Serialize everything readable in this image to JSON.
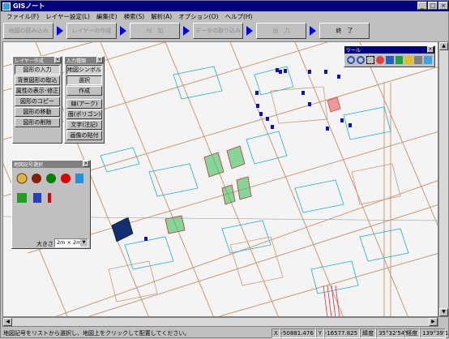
{
  "app": {
    "title": "GISノート"
  },
  "window_buttons": [
    "_",
    "□",
    "×"
  ],
  "menu": [
    "ファイル(F)",
    "レイヤー設定(L)",
    "編集(E)",
    "検索(S)",
    "解析(A)",
    "オプション(O)",
    "ヘルプ(H)"
  ],
  "steps": [
    "地図の読み込み",
    "レイヤーの作成",
    "付　加",
    "データの取り込み",
    "出　力",
    "終　了"
  ],
  "layer_panel": {
    "title": "レイヤー作成",
    "buttons": [
      "図形の入力",
      "背景図形の取込",
      "属性の表示･修正",
      "図形のコピー",
      "図形の移動",
      "図形の削除"
    ]
  },
  "input_panel": {
    "title": "入力種類",
    "buttons": [
      "地図シンボル",
      "選択",
      "作成",
      "線(アーク)",
      "面(ポリゴン)",
      "文字(注記)",
      "画像の貼付"
    ]
  },
  "symbol_panel": {
    "title": "地図記号選択",
    "size_label": "大きさ",
    "size_value": "2m × 2m"
  },
  "tool_panel": {
    "title": "ツール"
  },
  "status": {
    "message": "地図記号をリストから選択し、地図上をクリックして配置してください。",
    "x_label": "X",
    "x_value": "-50881.476",
    "y_label": "Y",
    "y_value": "-16577.825",
    "lat_label": "緯度",
    "lat_value": "35°32'54\"",
    "lon_label": "経度",
    "lon_value": "139°39'1\""
  },
  "colors": {
    "title_bar": "#000080",
    "step_arrow": "#0000e0",
    "road": "#c89a78",
    "parcel": "#20b0c8",
    "marker": "#1010c0",
    "green_fill": "#40c060",
    "red_fill": "#e04040"
  }
}
